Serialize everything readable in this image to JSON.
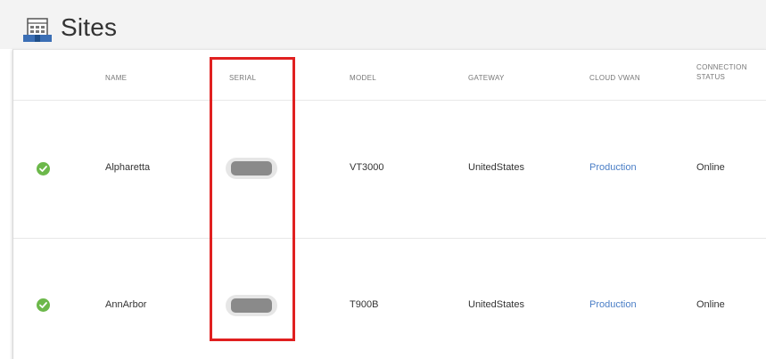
{
  "header": {
    "title": "Sites",
    "icon": "building-icon"
  },
  "table": {
    "columns": {
      "name": "NAME",
      "serial": "SERIAL",
      "model": "MODEL",
      "gateway": "GATEWAY",
      "cloud_vwan": "CLOUD VWAN",
      "connection_status_line1": "CONNECTION",
      "connection_status_line2": "STATUS"
    },
    "rows": [
      {
        "status_icon": "check-circle-icon",
        "name": "Alpharetta",
        "serial": "",
        "model": "VT3000",
        "gateway": "UnitedStates",
        "cloud_vwan": "Production",
        "connection_status": "Online"
      },
      {
        "status_icon": "check-circle-icon",
        "name": "AnnArbor",
        "serial": "",
        "model": "T900B",
        "gateway": "UnitedStates",
        "cloud_vwan": "Production",
        "connection_status": "Online"
      }
    ]
  },
  "colors": {
    "status_ok": "#6cb84a",
    "link": "#4a7ec6",
    "highlight": "#e02020"
  }
}
